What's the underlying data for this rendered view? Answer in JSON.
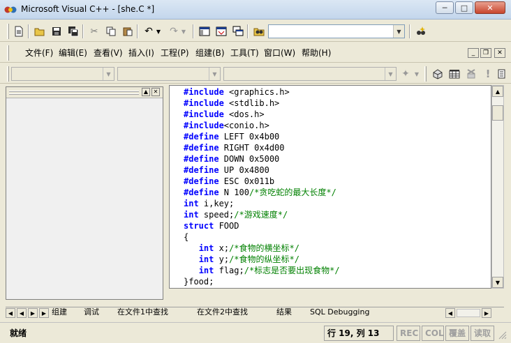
{
  "window": {
    "title": "Microsoft Visual C++ - [she.C *]",
    "minimize": "─",
    "maximize": "□",
    "close": "✕"
  },
  "menu": {
    "items": [
      "文件(F)",
      "编辑(E)",
      "查看(V)",
      "插入(I)",
      "工程(P)",
      "组建(B)",
      "工具(T)",
      "窗口(W)",
      "帮助(H)"
    ],
    "mdi_minimize": "_",
    "mdi_restore": "❐",
    "mdi_close": "✕"
  },
  "code": {
    "lines": [
      [
        {
          "t": "kw",
          "v": "#include"
        },
        {
          "t": "tx",
          "v": " <graphics.h>"
        }
      ],
      [
        {
          "t": "kw",
          "v": "#include"
        },
        {
          "t": "tx",
          "v": " <stdlib.h>"
        }
      ],
      [
        {
          "t": "kw",
          "v": "#include"
        },
        {
          "t": "tx",
          "v": " <dos.h>"
        }
      ],
      [
        {
          "t": "kw",
          "v": "#include"
        },
        {
          "t": "tx",
          "v": "<conio.h>"
        }
      ],
      [
        {
          "t": "kw",
          "v": "#define"
        },
        {
          "t": "tx",
          "v": " LEFT 0x4b00"
        }
      ],
      [
        {
          "t": "kw",
          "v": "#define"
        },
        {
          "t": "tx",
          "v": " RIGHT 0x4d00"
        }
      ],
      [
        {
          "t": "kw",
          "v": "#define"
        },
        {
          "t": "tx",
          "v": " DOWN 0x5000"
        }
      ],
      [
        {
          "t": "kw",
          "v": "#define"
        },
        {
          "t": "tx",
          "v": " UP 0x4800"
        }
      ],
      [
        {
          "t": "kw",
          "v": "#define"
        },
        {
          "t": "tx",
          "v": " ESC 0x011b"
        }
      ],
      [
        {
          "t": "kw",
          "v": "#define"
        },
        {
          "t": "tx",
          "v": " N 100"
        },
        {
          "t": "cm",
          "v": "/*贪吃蛇的最大长度*/"
        }
      ],
      [
        {
          "t": "kw",
          "v": "int"
        },
        {
          "t": "tx",
          "v": " i,key;"
        }
      ],
      [
        {
          "t": "kw",
          "v": "int"
        },
        {
          "t": "tx",
          "v": " speed;"
        },
        {
          "t": "cm",
          "v": "/*游戏速度*/"
        }
      ],
      [
        {
          "t": "kw",
          "v": "struct"
        },
        {
          "t": "tx",
          "v": " FOOD"
        }
      ],
      [
        {
          "t": "tx",
          "v": "{"
        }
      ],
      [
        {
          "t": "tx",
          "v": "   "
        },
        {
          "t": "kw",
          "v": "int"
        },
        {
          "t": "tx",
          "v": " x;"
        },
        {
          "t": "cm",
          "v": "/*食物的横坐标*/"
        }
      ],
      [
        {
          "t": "tx",
          "v": "   "
        },
        {
          "t": "kw",
          "v": "int"
        },
        {
          "t": "tx",
          "v": " y;"
        },
        {
          "t": "cm",
          "v": "/*食物的纵坐标*/"
        }
      ],
      [
        {
          "t": "tx",
          "v": "   "
        },
        {
          "t": "kw",
          "v": "int"
        },
        {
          "t": "tx",
          "v": " flag;"
        },
        {
          "t": "cm",
          "v": "/*标志是否要出现食物*/"
        }
      ],
      [
        {
          "t": "tx",
          "v": "}food;"
        }
      ]
    ]
  },
  "output_tabs": [
    "组建",
    "调试",
    "在文件1中查找",
    "在文件2中查找",
    "结果",
    "SQL Debugging"
  ],
  "status": {
    "message": "就绪",
    "position": "行 19, 列 13",
    "rec": "REC",
    "col": "COL",
    "ovr": "覆盖",
    "read": "读取"
  },
  "colors": {
    "keyword": "#0000ff",
    "comment": "#008000",
    "text": "#000000"
  },
  "icons": {
    "toolbar1": [
      "new-text-file-icon",
      "open-folder-icon",
      "save-icon",
      "save-all-icon",
      "cut-icon",
      "copy-icon",
      "paste-icon",
      "undo-icon",
      "redo-icon",
      "workspace-icon",
      "output-icon",
      "window-list-icon",
      "find-in-files-icon",
      "find-combo",
      "search-icon"
    ],
    "toolbar2": [
      "wizard-icon",
      "compile-icon",
      "build-icon",
      "stop-build-icon",
      "execute-icon",
      "breakpoint-icon"
    ]
  }
}
